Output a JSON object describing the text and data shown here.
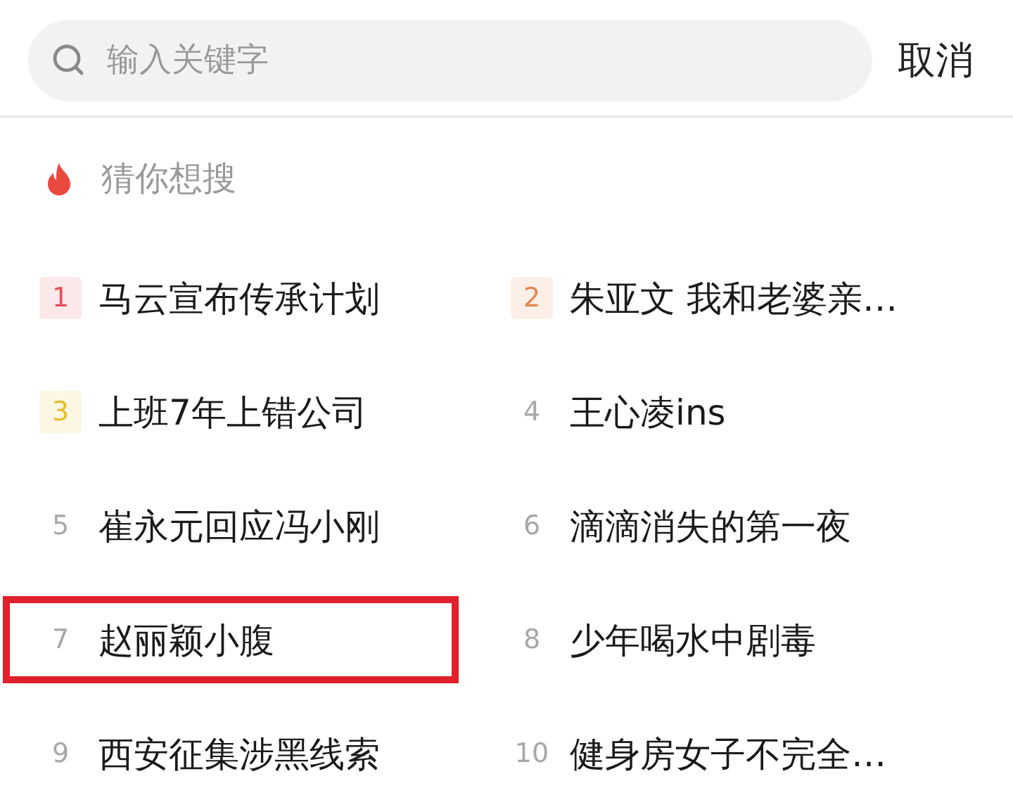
{
  "search": {
    "placeholder": "输入关键字"
  },
  "cancel_button": "取消",
  "section": {
    "title": "猜你想搜"
  },
  "suggestions": [
    {
      "rank": "1",
      "title": "马云宣布传承计划",
      "color": "#e0505a",
      "highlighted": false
    },
    {
      "rank": "2",
      "title": "朱亚文 我和老婆亲…",
      "color": "#e2874f",
      "highlighted": false
    },
    {
      "rank": "3",
      "title": "上班7年上错公司",
      "color": "#e5be2c",
      "highlighted": false
    },
    {
      "rank": "4",
      "title": "王心凌ins",
      "highlighted": false
    },
    {
      "rank": "5",
      "title": "崔永元回应冯小刚",
      "highlighted": false
    },
    {
      "rank": "6",
      "title": "滴滴消失的第一夜",
      "highlighted": false
    },
    {
      "rank": "7",
      "title": "赵丽颖小腹",
      "highlighted": true
    },
    {
      "rank": "8",
      "title": "少年喝水中剧毒",
      "highlighted": false
    },
    {
      "rank": "9",
      "title": "西安征集涉黑线索",
      "highlighted": false
    },
    {
      "rank": "10",
      "title": "健身房女子不完全…",
      "highlighted": false
    }
  ]
}
